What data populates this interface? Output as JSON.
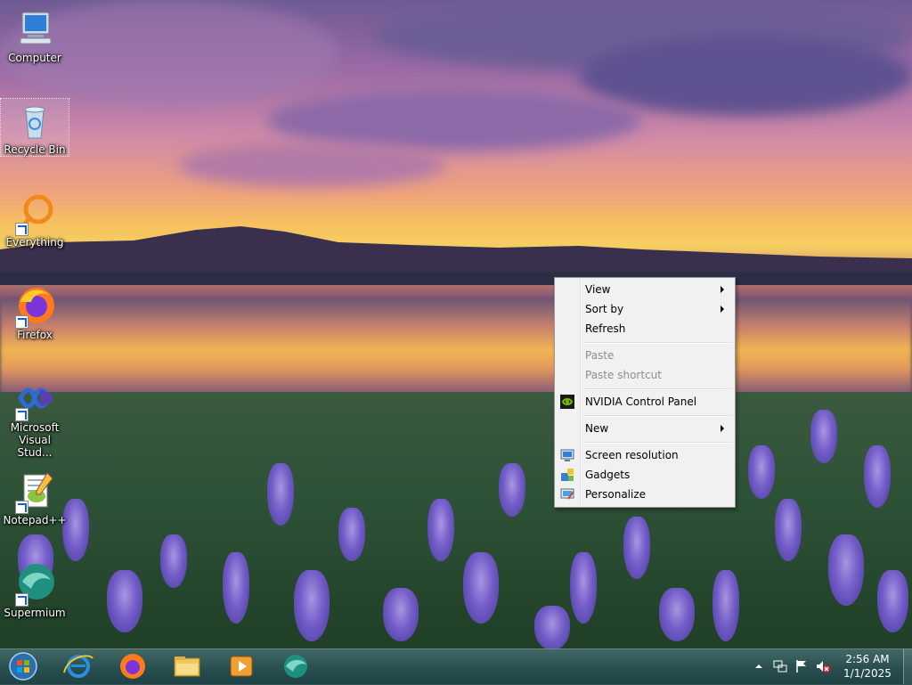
{
  "desktop": {
    "icons": [
      {
        "label": "Computer"
      },
      {
        "label": "Recycle Bin"
      },
      {
        "label": "Everything"
      },
      {
        "label": "Firefox"
      },
      {
        "label": "Microsoft Visual Stud..."
      },
      {
        "label": "Notepad++"
      },
      {
        "label": "Supermium"
      }
    ]
  },
  "context_menu": {
    "items": [
      {
        "label": "View",
        "submenu": true
      },
      {
        "label": "Sort by",
        "submenu": true
      },
      {
        "label": "Refresh"
      },
      {
        "label": "Paste",
        "disabled": true
      },
      {
        "label": "Paste shortcut",
        "disabled": true
      },
      {
        "label": "NVIDIA Control Panel",
        "icon": "nvidia-icon"
      },
      {
        "label": "New",
        "submenu": true
      },
      {
        "label": "Screen resolution",
        "icon": "monitor-icon"
      },
      {
        "label": "Gadgets",
        "icon": "gadgets-icon"
      },
      {
        "label": "Personalize",
        "icon": "personalize-icon"
      }
    ]
  },
  "taskbar": {
    "apps": [
      "internet-explorer-icon",
      "firefox-icon",
      "file-explorer-icon",
      "media-player-icon",
      "supermium-icon"
    ],
    "tray_icons": [
      "show-hidden-icons-chevron",
      "network-icon",
      "action-center-flag-icon",
      "volume-muted-icon"
    ],
    "clock": {
      "time": "2:56 AM",
      "date": "1/1/2025"
    }
  },
  "colors": {
    "menu_bg": "#f1f1f1",
    "taskbar": "#2e5a5e",
    "disabled_text": "#8d8d8d"
  }
}
